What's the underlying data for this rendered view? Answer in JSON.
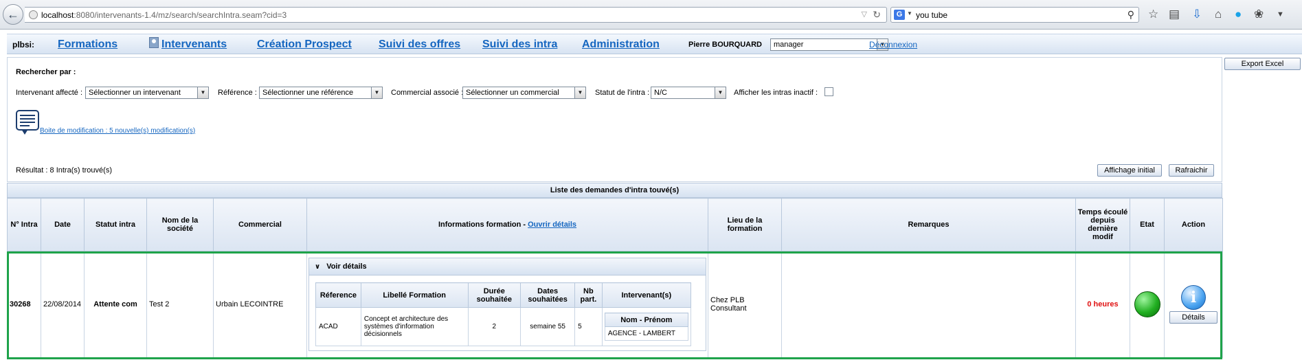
{
  "browser": {
    "url_host": "localhost",
    "url_rest": ":8080/intervenants-1.4/mz/search/searchIntra.seam?cid=3",
    "search_query": "you tube",
    "search_engine_icon": "G"
  },
  "nav": {
    "logo": "plbsi:",
    "links": [
      "Formations",
      "Intervenants",
      "Création Prospect",
      "Suivi des offres",
      "Suivi des intra",
      "Administration"
    ],
    "user_name": "Pierre BOURQUARD",
    "role_value": "manager",
    "logout": "Déconnexion"
  },
  "search": {
    "title": "Rechercher par :",
    "filters": [
      {
        "label": "Intervenant affecté :",
        "value": "Sélectionner un intervenant"
      },
      {
        "label": "Référence :",
        "value": "Sélectionner une référence"
      },
      {
        "label": "Commercial associé :",
        "value": "Sélectionner un commercial"
      },
      {
        "label": "Statut de l'intra :",
        "value": "N/C"
      }
    ],
    "inactive_label": "Afficher les intras inactif :",
    "modif_link": "Boite de modification : 5 nouvelle(s) modification(s)",
    "result_text": "Résultat : 8 Intra(s) trouvé(s)",
    "btn_initial": "Affichage initial",
    "btn_refresh": "Rafraichir",
    "btn_export": "Export Excel"
  },
  "table": {
    "title": "Liste des demandes d'intra touvé(s)",
    "headers": {
      "num": "N° Intra",
      "date": "Date",
      "status": "Statut intra",
      "company": "Nom de la société",
      "commercial": "Commercial",
      "info_prefix": "Informations formation - ",
      "info_link": "Ouvrir détails",
      "place": "Lieu de la formation",
      "remarks": "Remarques",
      "elapsed": "Temps écoulé depuis dernière modif",
      "state": "Etat",
      "action": "Action"
    },
    "row": {
      "num": "30268",
      "date": "22/08/2014",
      "status": "Attente com",
      "company": "Test 2",
      "commercial": "Urbain LECOINTRE",
      "place": "Chez PLB Consultant",
      "remarks": "",
      "elapsed": "0 heures",
      "details_btn": "Détails",
      "voir_details": "Voir détails",
      "inner_headers": {
        "ref": "Réference",
        "label": "Libellé Formation",
        "duration": "Durée souhaitée",
        "dates": "Dates souhaitées",
        "nb": "Nb part.",
        "interv": "Intervenant(s)"
      },
      "inner_row": {
        "ref": "ACAD",
        "label": "Concept et architecture des systèmes d'information décisionnels",
        "duration": "2",
        "dates": "semaine 55",
        "nb": "5"
      },
      "interv_header": "Nom - Prénom",
      "interv_name": "AGENCE - LAMBERT"
    }
  },
  "colors": {
    "link": "#1566c0",
    "highlight": "#1ea34a",
    "elapsed": "#e01010",
    "state_ok": "#22b022"
  }
}
